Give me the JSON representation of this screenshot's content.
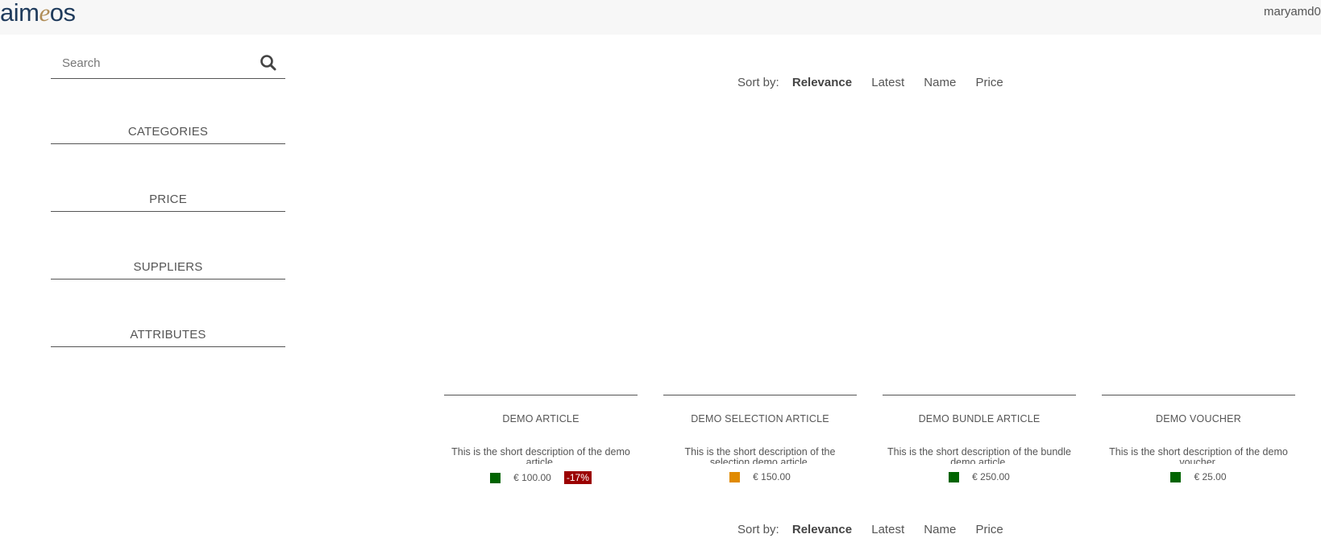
{
  "header": {
    "logo_main": "aim",
    "logo_e": "e",
    "logo_end": "os",
    "user": "maryamd0"
  },
  "search": {
    "placeholder": "Search",
    "icon": "search-icon"
  },
  "facets": [
    "CATEGORIES",
    "PRICE",
    "SUPPLIERS",
    "ATTRIBUTES"
  ],
  "sort": {
    "label": "Sort by:",
    "options": [
      "Relevance",
      "Latest",
      "Name",
      "Price"
    ],
    "active": "Relevance"
  },
  "products": [
    {
      "name": "DEMO ARTICLE",
      "desc": "This is the short description of the demo article.",
      "price": "€ 100.00",
      "badge": "-17%",
      "stock_color": "#006400"
    },
    {
      "name": "DEMO SELECTION ARTICLE",
      "desc": "This is the short description of the selection demo article.",
      "price": "€ 150.00",
      "badge": "",
      "stock_color": "#e08a00"
    },
    {
      "name": "DEMO BUNDLE ARTICLE",
      "desc": "This is the short description of the bundle demo article.",
      "price": "€ 250.00",
      "badge": "",
      "stock_color": "#006400"
    },
    {
      "name": "DEMO VOUCHER",
      "desc": "This is the short description of the demo voucher.",
      "price": "€ 25.00",
      "badge": "",
      "stock_color": "#006400"
    }
  ]
}
